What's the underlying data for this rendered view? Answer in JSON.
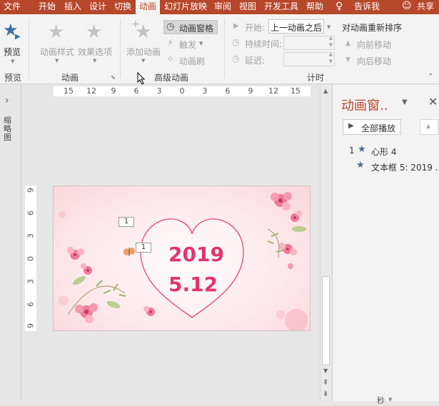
{
  "tabs": [
    "文件",
    "开始",
    "插入",
    "设计",
    "切换",
    "动画",
    "幻灯片放映",
    "审阅",
    "视图",
    "开发工具",
    "帮助",
    "告诉我",
    "共享"
  ],
  "ribbon": {
    "preview": "预览",
    "animation_styles": "动画样式",
    "effect_options": "效果选项",
    "add_animation": "添加动画",
    "animation_pane_btn": "动画窗格",
    "trigger": "触发",
    "animation_painter": "动画刷",
    "start_label": "开始:",
    "start_value": "上一动画之后",
    "duration_label": "持续时间:",
    "delay_label": "延迟:",
    "reorder_title": "对动画重新排序",
    "move_earlier": "向前移动",
    "move_later": "向后移动",
    "groups": {
      "preview": "预览",
      "animation": "动画",
      "advanced": "高级动画",
      "timing": "计时"
    }
  },
  "left_strip": {
    "label": "缩略图"
  },
  "ruler": {
    "h_ticks": [
      "15",
      "12",
      "9",
      "6",
      "3",
      "0",
      "3",
      "6",
      "9",
      "12",
      "15"
    ],
    "v_ticks": [
      "9",
      "6",
      "3",
      "0",
      "3",
      "6",
      "9"
    ]
  },
  "slide": {
    "line1": "2019",
    "line2": "5.12",
    "tag_heart": "1",
    "tag_text": "1"
  },
  "pane": {
    "title": "动画窗..",
    "play_all": "全部播放",
    "items": [
      {
        "index": "1",
        "name": "心形 4"
      },
      {
        "index": "",
        "name": "文本框 5: 2019 ..."
      }
    ],
    "footer": "秒"
  },
  "colors": {
    "accent": "#b7472a",
    "heart": "#e8407f",
    "text": "#e4336e"
  }
}
